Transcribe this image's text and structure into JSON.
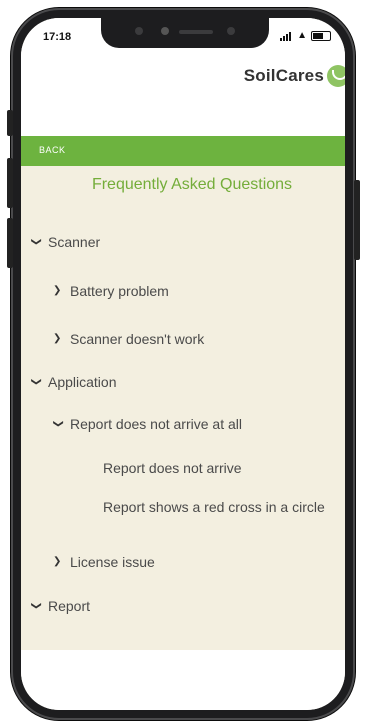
{
  "status_bar": {
    "time": "17:18"
  },
  "header": {
    "logo_text": "SoilCares"
  },
  "nav": {
    "back_label": "BACK"
  },
  "page": {
    "title": "Frequently Asked Questions"
  },
  "faq": {
    "scanner": {
      "label": "Scanner",
      "items": [
        "Battery problem",
        "Scanner doesn't work"
      ]
    },
    "application": {
      "label": "Application",
      "report_not_arrive": {
        "label": "Report does not arrive at all",
        "items": [
          "Report does not arrive",
          "Report shows a red cross in a circle"
        ]
      },
      "license": {
        "label": "License issue"
      }
    },
    "report": {
      "label": "Report"
    }
  },
  "colors": {
    "accent_green": "#6db33f",
    "title_green": "#74ad3a",
    "screen_bg": "#f3efe0"
  },
  "icons": [
    "chevron-down-icon",
    "chevron-right-icon",
    "signal-icon",
    "wifi-icon",
    "battery-icon",
    "soilcares-logo-icon"
  ]
}
